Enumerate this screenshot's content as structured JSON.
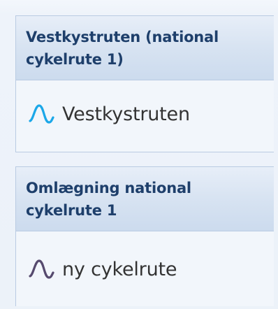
{
  "layers": [
    {
      "title": "Vestkystruten (national cykelrute 1)",
      "items": [
        {
          "label": "Vestkystruten",
          "icon": "wave-line-icon",
          "color": "#1ba7e8"
        }
      ]
    },
    {
      "title": "Omlægning national cykelrute 1",
      "items": [
        {
          "label": "ny cykelrute",
          "icon": "wave-line-icon",
          "color": "#564a6e"
        }
      ]
    }
  ]
}
